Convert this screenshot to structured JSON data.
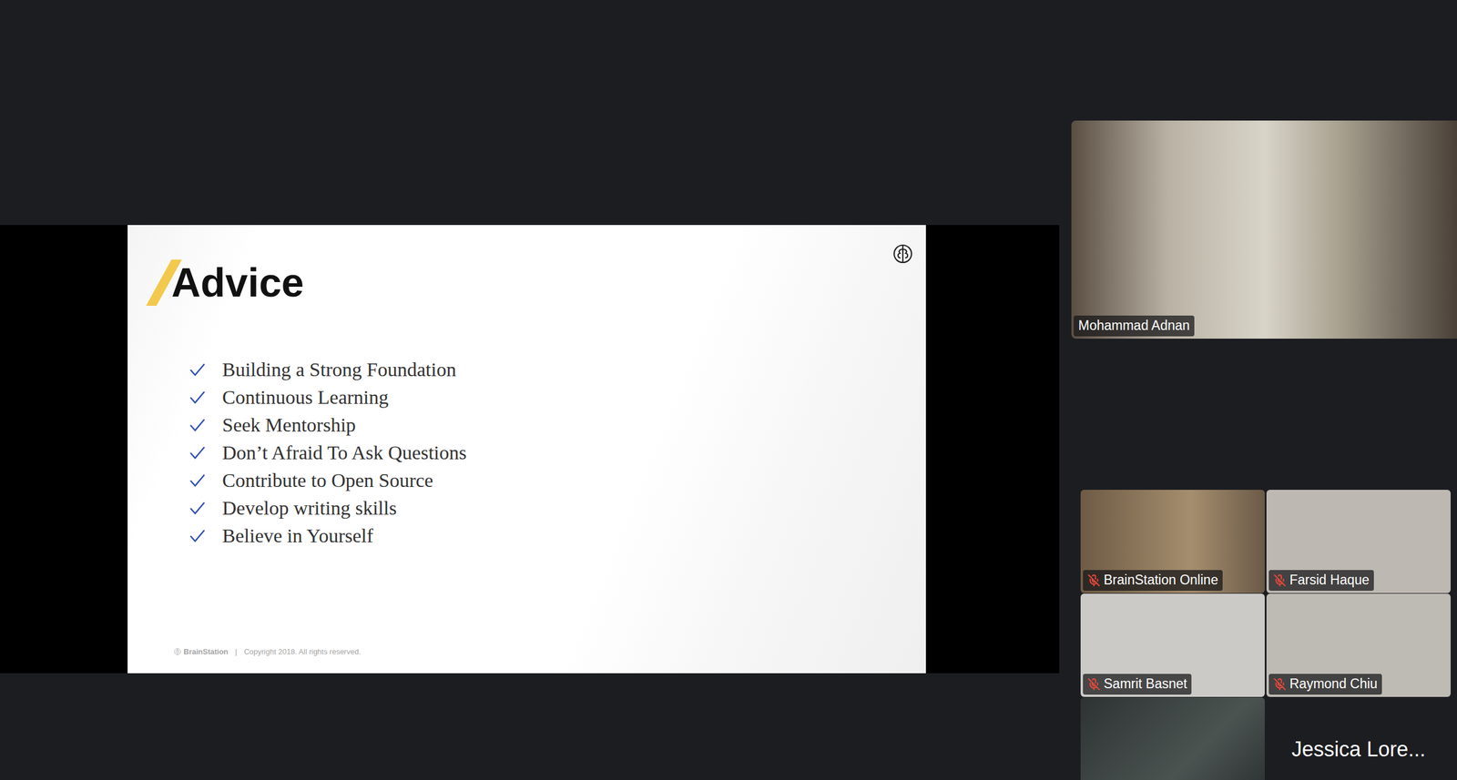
{
  "slide": {
    "title": "Advice",
    "items": [
      "Building a Strong Foundation",
      "Continuous Learning",
      "Seek Mentorship",
      "Don’t Afraid To Ask Questions",
      "Contribute to Open Source",
      "Develop writing skills",
      "Believe in Yourself"
    ],
    "footer": {
      "brand": "BrainStation",
      "separator": "|",
      "copyright": "Copyright 2018. All rights reserved."
    }
  },
  "speaker": {
    "name": "Mohammad Adnan",
    "muted": false
  },
  "participants": [
    {
      "name": "BrainStation Online",
      "muted": true,
      "kind": "video"
    },
    {
      "name": "Farsid Haque",
      "muted": true,
      "kind": "video"
    },
    {
      "name": "Samrit Basnet",
      "muted": true,
      "kind": "video"
    },
    {
      "name": "Raymond Chiu",
      "muted": true,
      "kind": "video"
    },
    {
      "muted": false,
      "kind": "video"
    },
    {
      "name": "Jessica Lore...",
      "muted": false,
      "kind": "name-only"
    }
  ]
}
